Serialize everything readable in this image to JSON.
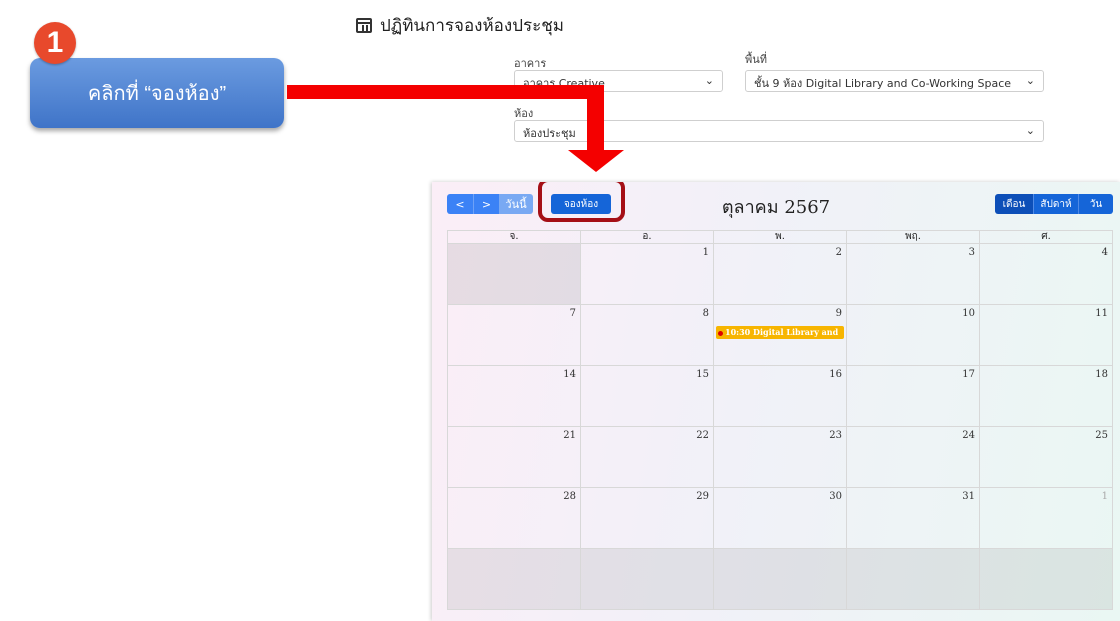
{
  "page": {
    "title": "ปฏิทินการจองห้องประชุม"
  },
  "filters": {
    "building_label": "อาคาร",
    "building_value": "อาคาร Creative",
    "area_label": "พื้นที่",
    "area_value": "ชั้น 9 ห้อง Digital Library and Co-Working Space",
    "room_label": "ห้อง",
    "room_value": "ห้องประชุม"
  },
  "tutorial": {
    "step_number": "1",
    "callout_text": "คลิกที่ “จองห้อง”",
    "arrow_color": "#f40000",
    "highlight_color": "#a50f16"
  },
  "calendar": {
    "prev_icon": "chevron-left-icon",
    "next_icon": "chevron-right-icon",
    "prev_label": "<",
    "next_label": ">",
    "today_label": "วันนี้",
    "book_label": "จองห้อง",
    "month_title": "ตุลาคม 2567",
    "views": {
      "month": "เดือน",
      "week": "สัปดาห์",
      "day": "วัน"
    },
    "weekdays": [
      "จ.",
      "อ.",
      "พ.",
      "พฤ.",
      "ศ."
    ],
    "weeks": [
      [
        "",
        "1",
        "2",
        "3",
        "4"
      ],
      [
        "7",
        "8",
        "9",
        "10",
        "11"
      ],
      [
        "14",
        "15",
        "16",
        "17",
        "18"
      ],
      [
        "21",
        "22",
        "23",
        "24",
        "25"
      ],
      [
        "28",
        "29",
        "30",
        "31",
        "1"
      ]
    ],
    "event": {
      "text": "10:30 Digital Library and",
      "color": "#f7b500"
    }
  }
}
